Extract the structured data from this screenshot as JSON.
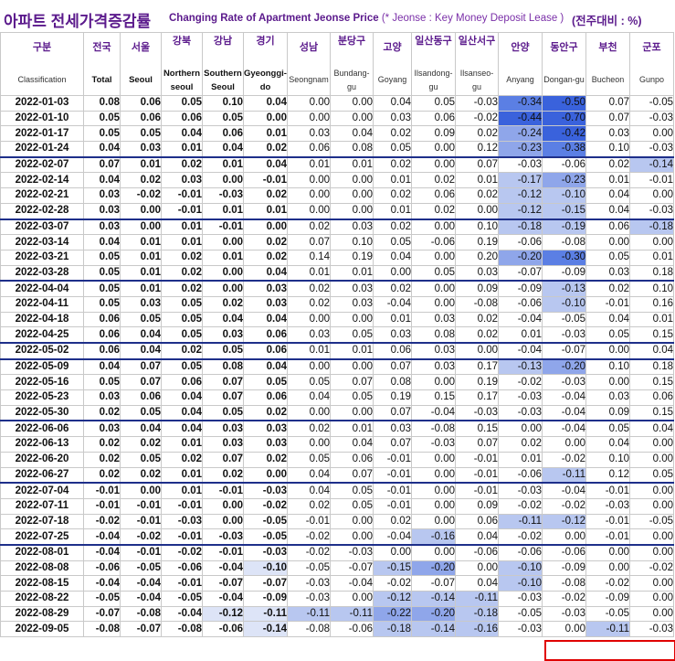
{
  "title": {
    "korean": "아파트 전세가격증감률",
    "english": "Changing Rate of Apartment Jeonse Price",
    "note": "(* Jeonse : Key Money Deposit Lease )",
    "unit": "(전주대비 : %)"
  },
  "columns": [
    {
      "ko": "구분",
      "en": "Classification"
    },
    {
      "ko": "전국",
      "en": "Total"
    },
    {
      "ko": "서울",
      "en": "Seoul"
    },
    {
      "ko": "강북",
      "en": "Northern seoul"
    },
    {
      "ko": "강남",
      "en": "Southern Seoul"
    },
    {
      "ko": "경기",
      "en": "Gyeonggi-do"
    },
    {
      "ko": "성남",
      "en": "Seongnam"
    },
    {
      "ko": "분당구",
      "en": "Bundang-gu"
    },
    {
      "ko": "고양",
      "en": "Goyang"
    },
    {
      "ko": "일산동구",
      "en": "Ilsandong-gu"
    },
    {
      "ko": "일산서구",
      "en": "Ilsanseo-gu"
    },
    {
      "ko": "안양",
      "en": "Anyang"
    },
    {
      "ko": "동안구",
      "en": "Dongan-gu"
    },
    {
      "ko": "부천",
      "en": "Bucheon"
    },
    {
      "ko": "군포",
      "en": "Gunpo"
    }
  ],
  "rows": [
    {
      "date": "2022-01-03",
      "v": [
        "0.08",
        "0.06",
        "0.05",
        "0.10",
        "0.04",
        "0.00",
        "0.00",
        "0.04",
        "0.05",
        "-0.03",
        "-0.34",
        "-0.50",
        "0.07",
        "-0.05"
      ]
    },
    {
      "date": "2022-01-10",
      "v": [
        "0.05",
        "0.06",
        "0.06",
        "0.05",
        "0.00",
        "0.00",
        "0.00",
        "0.03",
        "0.06",
        "-0.02",
        "-0.44",
        "-0.70",
        "0.07",
        "-0.03"
      ]
    },
    {
      "date": "2022-01-17",
      "v": [
        "0.05",
        "0.05",
        "0.04",
        "0.06",
        "0.01",
        "0.03",
        "0.04",
        "0.02",
        "0.09",
        "0.02",
        "-0.24",
        "-0.42",
        "0.03",
        "0.00"
      ]
    },
    {
      "date": "2022-01-24",
      "v": [
        "0.04",
        "0.03",
        "0.01",
        "0.04",
        "0.02",
        "0.06",
        "0.08",
        "0.05",
        "0.00",
        "0.12",
        "-0.23",
        "-0.38",
        "0.10",
        "-0.03"
      ]
    },
    {
      "date": "2022-02-07",
      "v": [
        "0.07",
        "0.01",
        "0.02",
        "0.01",
        "0.04",
        "0.01",
        "0.01",
        "0.02",
        "0.00",
        "0.07",
        "-0.03",
        "-0.06",
        "0.02",
        "-0.14"
      ]
    },
    {
      "date": "2022-02-14",
      "v": [
        "0.04",
        "0.02",
        "0.03",
        "0.00",
        "-0.01",
        "0.00",
        "0.00",
        "0.01",
        "0.02",
        "0.01",
        "-0.17",
        "-0.23",
        "0.01",
        "-0.01"
      ]
    },
    {
      "date": "2022-02-21",
      "v": [
        "0.03",
        "-0.02",
        "-0.01",
        "-0.03",
        "0.02",
        "0.00",
        "0.00",
        "0.02",
        "0.06",
        "0.02",
        "-0.12",
        "-0.10",
        "0.04",
        "0.00"
      ]
    },
    {
      "date": "2022-02-28",
      "v": [
        "0.03",
        "0.00",
        "-0.01",
        "0.01",
        "0.01",
        "0.00",
        "0.00",
        "0.01",
        "0.02",
        "0.00",
        "-0.12",
        "-0.15",
        "0.04",
        "-0.03"
      ]
    },
    {
      "date": "2022-03-07",
      "v": [
        "0.03",
        "0.00",
        "0.01",
        "-0.01",
        "0.00",
        "0.02",
        "0.03",
        "0.02",
        "0.00",
        "0.10",
        "-0.18",
        "-0.19",
        "0.06",
        "-0.18"
      ]
    },
    {
      "date": "2022-03-14",
      "v": [
        "0.04",
        "0.01",
        "0.01",
        "0.00",
        "0.02",
        "0.07",
        "0.10",
        "0.05",
        "-0.06",
        "0.19",
        "-0.06",
        "-0.08",
        "0.00",
        "0.00"
      ]
    },
    {
      "date": "2022-03-21",
      "v": [
        "0.05",
        "0.01",
        "0.02",
        "0.01",
        "0.02",
        "0.14",
        "0.19",
        "0.04",
        "0.00",
        "0.20",
        "-0.20",
        "-0.30",
        "0.05",
        "0.01"
      ]
    },
    {
      "date": "2022-03-28",
      "v": [
        "0.05",
        "0.01",
        "0.02",
        "0.00",
        "0.04",
        "0.01",
        "0.01",
        "0.00",
        "0.05",
        "0.03",
        "-0.07",
        "-0.09",
        "0.03",
        "0.18"
      ]
    },
    {
      "date": "2022-04-04",
      "v": [
        "0.05",
        "0.01",
        "0.02",
        "0.00",
        "0.03",
        "0.02",
        "0.03",
        "0.02",
        "0.00",
        "0.09",
        "-0.09",
        "-0.13",
        "0.02",
        "0.10"
      ]
    },
    {
      "date": "2022-04-11",
      "v": [
        "0.05",
        "0.03",
        "0.05",
        "0.02",
        "0.03",
        "0.02",
        "0.03",
        "-0.04",
        "0.00",
        "-0.08",
        "-0.06",
        "-0.10",
        "-0.01",
        "0.16"
      ]
    },
    {
      "date": "2022-04-18",
      "v": [
        "0.06",
        "0.05",
        "0.05",
        "0.04",
        "0.04",
        "0.00",
        "0.00",
        "0.01",
        "0.03",
        "0.02",
        "-0.04",
        "-0.05",
        "0.04",
        "0.01"
      ]
    },
    {
      "date": "2022-04-25",
      "v": [
        "0.06",
        "0.04",
        "0.05",
        "0.03",
        "0.06",
        "0.03",
        "0.05",
        "0.03",
        "0.08",
        "0.02",
        "0.01",
        "-0.03",
        "0.05",
        "0.15"
      ]
    },
    {
      "date": "2022-05-02",
      "v": [
        "0.06",
        "0.04",
        "0.02",
        "0.05",
        "0.06",
        "0.01",
        "0.01",
        "0.06",
        "0.03",
        "0.00",
        "-0.04",
        "-0.07",
        "0.00",
        "0.04"
      ]
    },
    {
      "date": "2022-05-09",
      "v": [
        "0.04",
        "0.07",
        "0.05",
        "0.08",
        "0.04",
        "0.00",
        "0.00",
        "0.07",
        "0.03",
        "0.17",
        "-0.13",
        "-0.20",
        "0.10",
        "0.18"
      ]
    },
    {
      "date": "2022-05-16",
      "v": [
        "0.05",
        "0.07",
        "0.06",
        "0.07",
        "0.05",
        "0.05",
        "0.07",
        "0.08",
        "0.00",
        "0.19",
        "-0.02",
        "-0.03",
        "0.00",
        "0.15"
      ]
    },
    {
      "date": "2022-05-23",
      "v": [
        "0.03",
        "0.06",
        "0.04",
        "0.07",
        "0.06",
        "0.04",
        "0.05",
        "0.19",
        "0.15",
        "0.17",
        "-0.03",
        "-0.04",
        "0.03",
        "0.06"
      ]
    },
    {
      "date": "2022-05-30",
      "v": [
        "0.02",
        "0.05",
        "0.04",
        "0.05",
        "0.02",
        "0.00",
        "0.00",
        "0.07",
        "-0.04",
        "-0.03",
        "-0.03",
        "-0.04",
        "0.09",
        "0.15"
      ]
    },
    {
      "date": "2022-06-06",
      "v": [
        "0.03",
        "0.04",
        "0.04",
        "0.03",
        "0.03",
        "0.02",
        "0.01",
        "0.03",
        "-0.08",
        "0.15",
        "0.00",
        "-0.04",
        "0.05",
        "0.04"
      ]
    },
    {
      "date": "2022-06-13",
      "v": [
        "0.02",
        "0.02",
        "0.01",
        "0.03",
        "0.03",
        "0.00",
        "0.04",
        "0.07",
        "-0.03",
        "0.07",
        "0.02",
        "0.00",
        "0.04",
        "0.00"
      ]
    },
    {
      "date": "2022-06-20",
      "v": [
        "0.02",
        "0.05",
        "0.02",
        "0.07",
        "0.02",
        "0.05",
        "0.06",
        "-0.01",
        "0.00",
        "-0.01",
        "0.01",
        "-0.02",
        "0.10",
        "0.00"
      ]
    },
    {
      "date": "2022-06-27",
      "v": [
        "0.02",
        "0.02",
        "0.01",
        "0.02",
        "0.00",
        "0.04",
        "0.07",
        "-0.01",
        "0.00",
        "-0.01",
        "-0.06",
        "-0.11",
        "0.12",
        "0.05"
      ]
    },
    {
      "date": "2022-07-04",
      "v": [
        "-0.01",
        "0.00",
        "0.01",
        "-0.01",
        "-0.03",
        "0.04",
        "0.05",
        "-0.01",
        "0.00",
        "-0.01",
        "-0.03",
        "-0.04",
        "-0.01",
        "0.00"
      ]
    },
    {
      "date": "2022-07-11",
      "v": [
        "-0.01",
        "-0.01",
        "-0.01",
        "0.00",
        "-0.02",
        "0.02",
        "0.05",
        "-0.01",
        "0.00",
        "0.09",
        "-0.02",
        "-0.02",
        "-0.03",
        "0.00"
      ]
    },
    {
      "date": "2022-07-18",
      "v": [
        "-0.02",
        "-0.01",
        "-0.03",
        "0.00",
        "-0.05",
        "-0.01",
        "0.00",
        "0.02",
        "0.00",
        "0.06",
        "-0.11",
        "-0.12",
        "-0.01",
        "-0.05"
      ]
    },
    {
      "date": "2022-07-25",
      "v": [
        "-0.04",
        "-0.02",
        "-0.01",
        "-0.03",
        "-0.05",
        "-0.02",
        "0.00",
        "-0.04",
        "-0.16",
        "0.04",
        "-0.02",
        "0.00",
        "-0.01",
        "0.00"
      ]
    },
    {
      "date": "2022-08-01",
      "v": [
        "-0.04",
        "-0.01",
        "-0.02",
        "-0.01",
        "-0.03",
        "-0.02",
        "-0.03",
        "0.00",
        "0.00",
        "-0.06",
        "-0.06",
        "-0.06",
        "0.00",
        "0.00"
      ]
    },
    {
      "date": "2022-08-08",
      "v": [
        "-0.06",
        "-0.05",
        "-0.06",
        "-0.04",
        "-0.10",
        "-0.05",
        "-0.07",
        "-0.15",
        "-0.20",
        "0.00",
        "-0.10",
        "-0.09",
        "0.00",
        "-0.02"
      ]
    },
    {
      "date": "2022-08-15",
      "v": [
        "-0.04",
        "-0.04",
        "-0.01",
        "-0.07",
        "-0.07",
        "-0.03",
        "-0.04",
        "-0.02",
        "-0.07",
        "0.04",
        "-0.10",
        "-0.08",
        "-0.02",
        "0.00"
      ]
    },
    {
      "date": "2022-08-22",
      "v": [
        "-0.05",
        "-0.04",
        "-0.05",
        "-0.04",
        "-0.09",
        "-0.03",
        "0.00",
        "-0.12",
        "-0.14",
        "-0.11",
        "-0.03",
        "-0.02",
        "-0.09",
        "0.00"
      ]
    },
    {
      "date": "2022-08-29",
      "v": [
        "-0.07",
        "-0.08",
        "-0.04",
        "-0.12",
        "-0.11",
        "-0.11",
        "-0.11",
        "-0.22",
        "-0.20",
        "-0.18",
        "-0.05",
        "-0.03",
        "-0.05",
        "0.00"
      ]
    },
    {
      "date": "2022-09-05",
      "v": [
        "-0.08",
        "-0.07",
        "-0.08",
        "-0.06",
        "-0.14",
        "-0.08",
        "-0.06",
        "-0.18",
        "-0.14",
        "-0.16",
        "-0.03",
        "0.00",
        "-0.11",
        "-0.03"
      ]
    }
  ],
  "colors": {
    "title": "#5b1a8c",
    "rule": "#1e2f8a",
    "highlight": "#e00000"
  }
}
